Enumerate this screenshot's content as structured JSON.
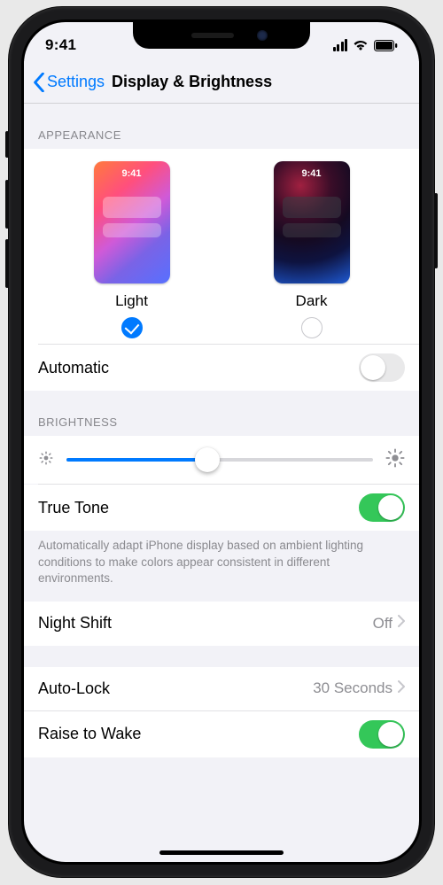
{
  "status": {
    "time": "9:41"
  },
  "nav": {
    "back": "Settings",
    "title": "Display & Brightness"
  },
  "appearance": {
    "header": "APPEARANCE",
    "options": [
      {
        "label": "Light",
        "thumb_time": "9:41",
        "selected": true
      },
      {
        "label": "Dark",
        "thumb_time": "9:41",
        "selected": false
      }
    ],
    "automatic": {
      "label": "Automatic",
      "on": false
    }
  },
  "brightness": {
    "header": "BRIGHTNESS",
    "value_pct": 46,
    "truetone": {
      "label": "True Tone",
      "on": true
    },
    "footnote": "Automatically adapt iPhone display based on ambient lighting conditions to make colors appear consistent in different environments."
  },
  "night_shift": {
    "label": "Night Shift",
    "value": "Off"
  },
  "auto_lock": {
    "label": "Auto-Lock",
    "value": "30 Seconds"
  },
  "raise_to_wake": {
    "label": "Raise to Wake",
    "on": true
  }
}
